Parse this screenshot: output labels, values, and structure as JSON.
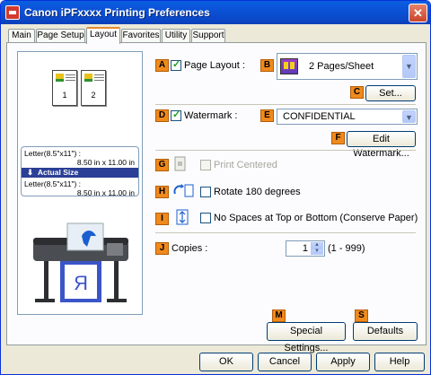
{
  "window": {
    "title": "Canon iPFxxxx Printing Preferences"
  },
  "tabs": [
    {
      "label": "Main"
    },
    {
      "label": "Page Setup"
    },
    {
      "label": "Layout"
    },
    {
      "label": "Favorites"
    },
    {
      "label": "Utility"
    },
    {
      "label": "Support"
    }
  ],
  "active_tab": "Layout",
  "preview": {
    "page1": "1",
    "page2": "2",
    "original_size": "Letter(8.5\"x11\") :",
    "original_dims": "8.50 in x 11.00 in",
    "mode": "Actual Size",
    "output_size": "Letter(8.5\"x11\") :",
    "output_dims": "8.50 in x 11.00 in",
    "sheet_letter": "R"
  },
  "badges": {
    "A": "A",
    "B": "B",
    "C": "C",
    "D": "D",
    "E": "E",
    "F": "F",
    "G": "G",
    "H": "H",
    "I": "I",
    "J": "J",
    "M": "M",
    "S": "S"
  },
  "page_layout": {
    "label": "Page Layout :",
    "checked": true,
    "value": "2 Pages/Sheet",
    "set_button": "Set..."
  },
  "watermark": {
    "label": "Watermark :",
    "checked": true,
    "value": "CONFIDENTIAL",
    "edit_button": "Edit Watermark..."
  },
  "print_centered": {
    "label": "Print Centered",
    "checked": false,
    "enabled": false
  },
  "rotate": {
    "label": "Rotate 180 degrees",
    "checked": false
  },
  "no_spaces": {
    "label": "No Spaces at Top or Bottom (Conserve Paper)",
    "checked": false
  },
  "copies": {
    "label": "Copies :",
    "value": "1",
    "range": "(1 - 999)"
  },
  "special_settings": "Special Settings...",
  "defaults": "Defaults",
  "footer": {
    "ok": "OK",
    "cancel": "Cancel",
    "apply": "Apply",
    "help": "Help"
  },
  "colors": {
    "badge": "#f08a1c",
    "title_bar": "#0b52d6",
    "active_tab_accent": "#e68b2c",
    "selection": "#2a3f95"
  }
}
